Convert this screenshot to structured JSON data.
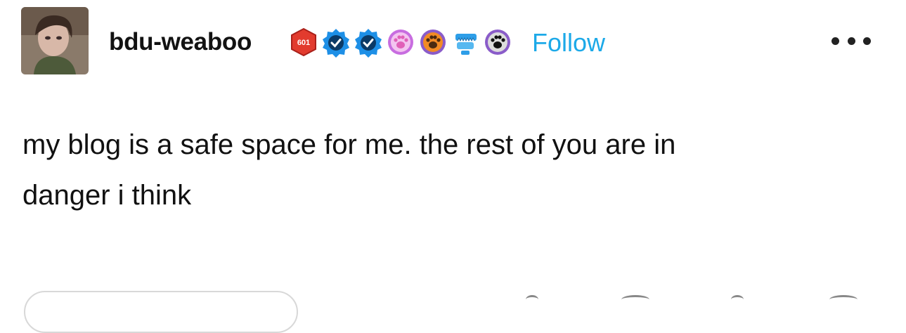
{
  "post": {
    "author": {
      "username": "bdu-weaboo",
      "avatar_icon": "user-avatar"
    },
    "badges": [
      {
        "icon": "red-hexagon-badge-icon",
        "label": "601",
        "color": "#e23b2e"
      },
      {
        "icon": "blue-verified-badge-icon",
        "color": "#1d8fe6"
      },
      {
        "icon": "blue-verified-badge-icon",
        "color": "#1d8fe6"
      },
      {
        "icon": "pink-paw-badge-icon",
        "color": "#c86de0"
      },
      {
        "icon": "orange-paw-badge-icon",
        "color": "#f28b25"
      },
      {
        "icon": "blue-jaw-badge-icon",
        "color": "#2e9ee8"
      },
      {
        "icon": "black-paw-badge-icon",
        "color": "#8a5cc9"
      }
    ],
    "follow_label": "Follow",
    "more_menu_icon": "more-options-icon",
    "body_lines": [
      "my blog is a safe space for me. the rest of you are in",
      "danger i think"
    ]
  },
  "colors": {
    "accent": "#1ca9e8",
    "text": "#111111",
    "background": "#ffffff"
  }
}
